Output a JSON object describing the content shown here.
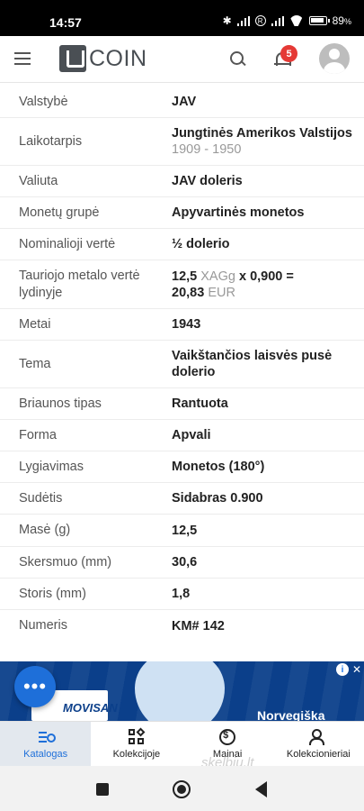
{
  "status_bar": {
    "time": "14:57",
    "battery": "89",
    "battery_unit": "%"
  },
  "app_bar": {
    "logo_text": "COIN",
    "notification_count": "5"
  },
  "details": [
    {
      "label": "Valstybė",
      "value": "JAV"
    },
    {
      "label": "Laikotarpis",
      "value": "Jungtinės Amerikos Valstijos",
      "sub": "1909 - 1950"
    },
    {
      "label": "Valiuta",
      "value": "JAV doleris"
    },
    {
      "label": "Monetų grupė",
      "value": "Apyvartinės monetos"
    },
    {
      "label": "Nominalioji vertė",
      "value": "½ dolerio"
    },
    {
      "label": "Tauriojo metalo vertė lydinyje",
      "value_parts": {
        "amount": "12,5",
        "unit": "XAGg",
        "mult": "x 0,900 =",
        "total": "20,83",
        "currency": "EUR"
      }
    },
    {
      "label": "Metai",
      "value": "1943"
    },
    {
      "label": "Tema",
      "value": "Vaikštančios laisvės pusė dolerio"
    },
    {
      "label": "Briaunos tipas",
      "value": "Rantuota"
    },
    {
      "label": "Forma",
      "value": "Apvali"
    },
    {
      "label": "Lygiavimas",
      "value": "Monetos (180°)"
    },
    {
      "label": "Sudėtis",
      "value": "Sidabras 0.900"
    },
    {
      "label": "Masė (g)",
      "value": "12,5"
    },
    {
      "label": "Skersmuo (mm)",
      "value": "30,6"
    },
    {
      "label": "Storis (mm)",
      "value": "1,8"
    },
    {
      "label": "Numeris",
      "value": "KM# 142",
      "link": true
    }
  ],
  "ad": {
    "brand": "MOVISAN",
    "headline": "Norvegiška",
    "info": "i",
    "close": "✕"
  },
  "fab": {
    "label": "•••"
  },
  "bottom_nav": [
    {
      "label": "Katalogas",
      "active": true
    },
    {
      "label": "Kolekcijoje"
    },
    {
      "label": "Mainai"
    },
    {
      "label": "Kolekcionieriai"
    }
  ],
  "watermark": "skelbiu.lt"
}
